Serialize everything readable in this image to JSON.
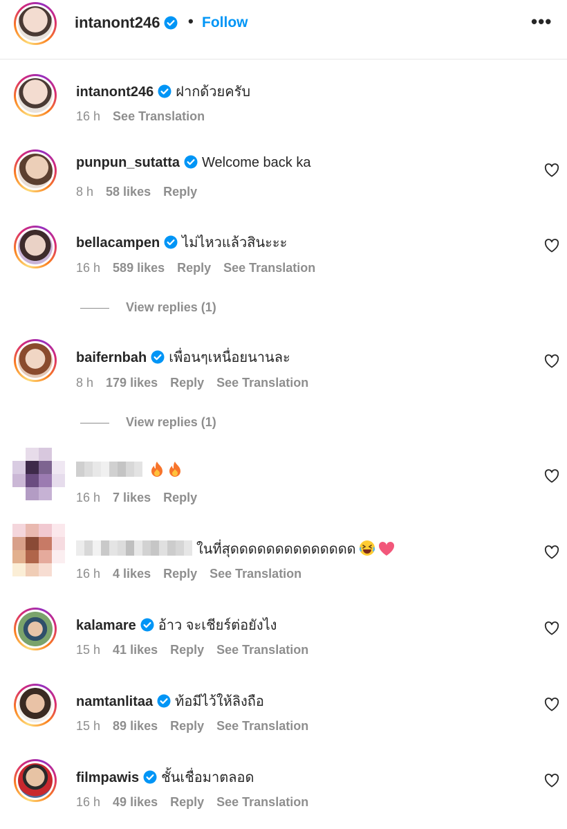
{
  "header": {
    "username": "intanont246",
    "dot": "•",
    "follow_label": "Follow",
    "more_label": "•••"
  },
  "comments": [
    {
      "user": "intanont246",
      "verified": true,
      "text": "ฝากด้วยครับ",
      "time": "16 h",
      "likes": "",
      "reply": "",
      "translate": "See Translation",
      "liked_icon": false
    },
    {
      "user": "punpun_sutatta",
      "verified": true,
      "text": "Welcome back ka",
      "time": "8 h",
      "likes": "58 likes",
      "reply": "Reply",
      "translate": "",
      "liked_icon": true
    },
    {
      "user": "bellacampen",
      "verified": true,
      "text": "ไม่ไหวแล้วสินะะะ",
      "time": "16 h",
      "likes": "589 likes",
      "reply": "Reply",
      "translate": "See Translation",
      "liked_icon": true,
      "view_replies": "View replies (1)"
    },
    {
      "user": "baifernbah",
      "verified": true,
      "text": "เพื่อนๆเหนื่อยนานละ",
      "time": "8 h",
      "likes": "179 likes",
      "reply": "Reply",
      "translate": "See Translation",
      "liked_icon": true,
      "view_replies": "View replies (1)"
    },
    {
      "user": "",
      "verified": false,
      "text": "",
      "time": "16 h",
      "likes": "7 likes",
      "reply": "Reply",
      "translate": "",
      "liked_icon": true,
      "emoji": [
        "fire",
        "fire"
      ]
    },
    {
      "user": "",
      "verified": false,
      "text": "ในที่สุดดดดดดดดดดดดดด",
      "time": "16 h",
      "likes": "4 likes",
      "reply": "Reply",
      "translate": "See Translation",
      "liked_icon": true,
      "emoji": [
        "laughing-face",
        "pink-heart"
      ]
    },
    {
      "user": "kalamare",
      "verified": true,
      "text": "อ้าว จะเชียร์ต่อยังไง",
      "time": "15 h",
      "likes": "41 likes",
      "reply": "Reply",
      "translate": "See Translation",
      "liked_icon": true
    },
    {
      "user": "namtanlitaa",
      "verified": true,
      "text": "ท้อมีไว้ให้ลิงถือ",
      "time": "15 h",
      "likes": "89 likes",
      "reply": "Reply",
      "translate": "See Translation",
      "liked_icon": true
    },
    {
      "user": "filmpawis",
      "verified": true,
      "text": "ชั้นเชื่อมาตลอด",
      "time": "16 h",
      "likes": "49 likes",
      "reply": "Reply",
      "translate": "See Translation",
      "liked_icon": true
    }
  ],
  "colors": {
    "follow": "#0095f6",
    "verified": "#0095f6",
    "meta": "#8e8e8e",
    "text": "#262626"
  }
}
